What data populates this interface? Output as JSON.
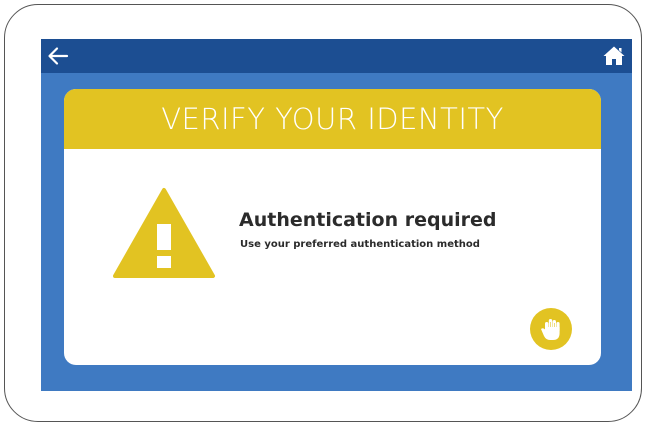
{
  "header": {
    "back_icon": "arrow-left-icon",
    "home_icon": "home-icon"
  },
  "card": {
    "title": "VERIFY YOUR IDENTITY",
    "icon": "warning-icon",
    "heading": "Authentication required",
    "subtitle": "Use your preferred authentication method",
    "action_icon": "touch-hand-icon"
  },
  "colors": {
    "screen_background": "#3f7ac2",
    "top_bar": "#1c4e92",
    "accent_yellow": "#e2c322",
    "card_background": "#ffffff",
    "text": "#2b2b2b"
  }
}
